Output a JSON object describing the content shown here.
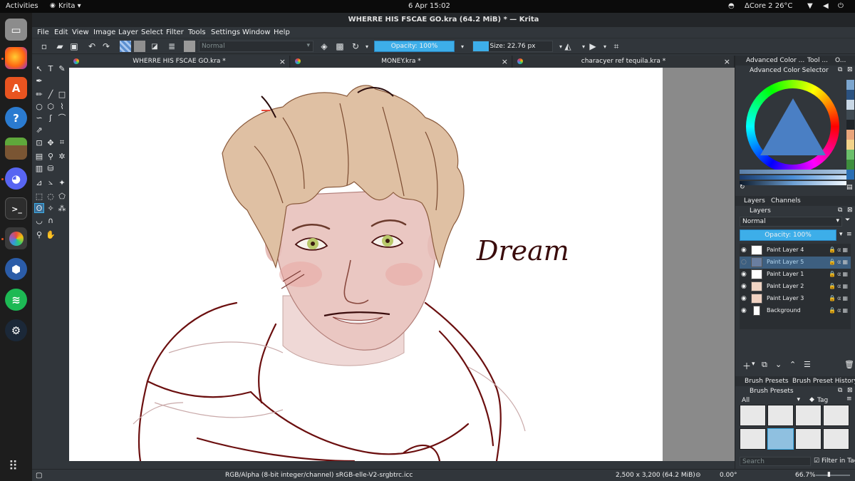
{
  "topbar": {
    "activities": "Activities",
    "app_menu": "Krita ▾",
    "clock": "6 Apr  15:02",
    "cpu": "ΔCore 2 26°C",
    "icons": [
      "discord-tray-icon",
      "wifi-icon",
      "volume-icon",
      "power-icon"
    ]
  },
  "dock": {
    "apps": [
      "files",
      "firefox",
      "software",
      "help",
      "minecraft",
      "discord",
      "terminal",
      "krita",
      "monkey",
      "spotify",
      "steam"
    ],
    "show_apps_icon": "grid-icon"
  },
  "window": {
    "title": "WHERRE HIS FSCAE GO.kra (64.2 MiB)  * — Krita"
  },
  "menu": [
    "File",
    "Edit",
    "View",
    "Image",
    "Layer",
    "Select",
    "Filter",
    "Tools",
    "Settings",
    "Window",
    "Help"
  ],
  "toolbar": {
    "blend_mode": "Normal",
    "opacity": "Opacity: 100%",
    "size": "Size: 22.76 px"
  },
  "tabs": [
    {
      "label": "WHERRE HIS FSCAE GO.kra *"
    },
    {
      "label": "MONEY.kra *"
    },
    {
      "label": "characyer ref tequila.kra *"
    }
  ],
  "canvas": {
    "signature": "Dream"
  },
  "dockers": {
    "top_tabs": [
      "Advanced Color ...",
      "Tool ...",
      "O..."
    ],
    "color_selector_title": "Advanced Color Selector",
    "layers_tabs": [
      "Layers",
      "Channels"
    ],
    "layers_title": "Layers",
    "layers_blend": "Normal",
    "layers_opacity": "Opacity:  100%",
    "layers": [
      {
        "name": "Paint Layer 4",
        "visible": true,
        "selected": false
      },
      {
        "name": "Paint Layer 5",
        "visible": false,
        "selected": true
      },
      {
        "name": "Paint Layer 1",
        "visible": true,
        "selected": false
      },
      {
        "name": "Paint Layer 2",
        "visible": true,
        "selected": false
      },
      {
        "name": "Paint Layer 3",
        "visible": true,
        "selected": false
      },
      {
        "name": "Background",
        "visible": true,
        "selected": false
      }
    ],
    "brush_tabs": [
      "Brush Presets",
      "Brush Preset History"
    ],
    "brush_title": "Brush Presets",
    "brush_filter": "All",
    "brush_tag": "Tag",
    "search_placeholder": "Search",
    "filter_in_tag": "Filter in Tag"
  },
  "status": {
    "color_profile": "RGB/Alpha (8-bit integer/channel)  sRGB-elle-V2-srgbtrc.icc",
    "image_size": "2,500 x 3,200 (64.2 MiB)",
    "rotation": "0.00°",
    "zoom": "66.7%"
  }
}
